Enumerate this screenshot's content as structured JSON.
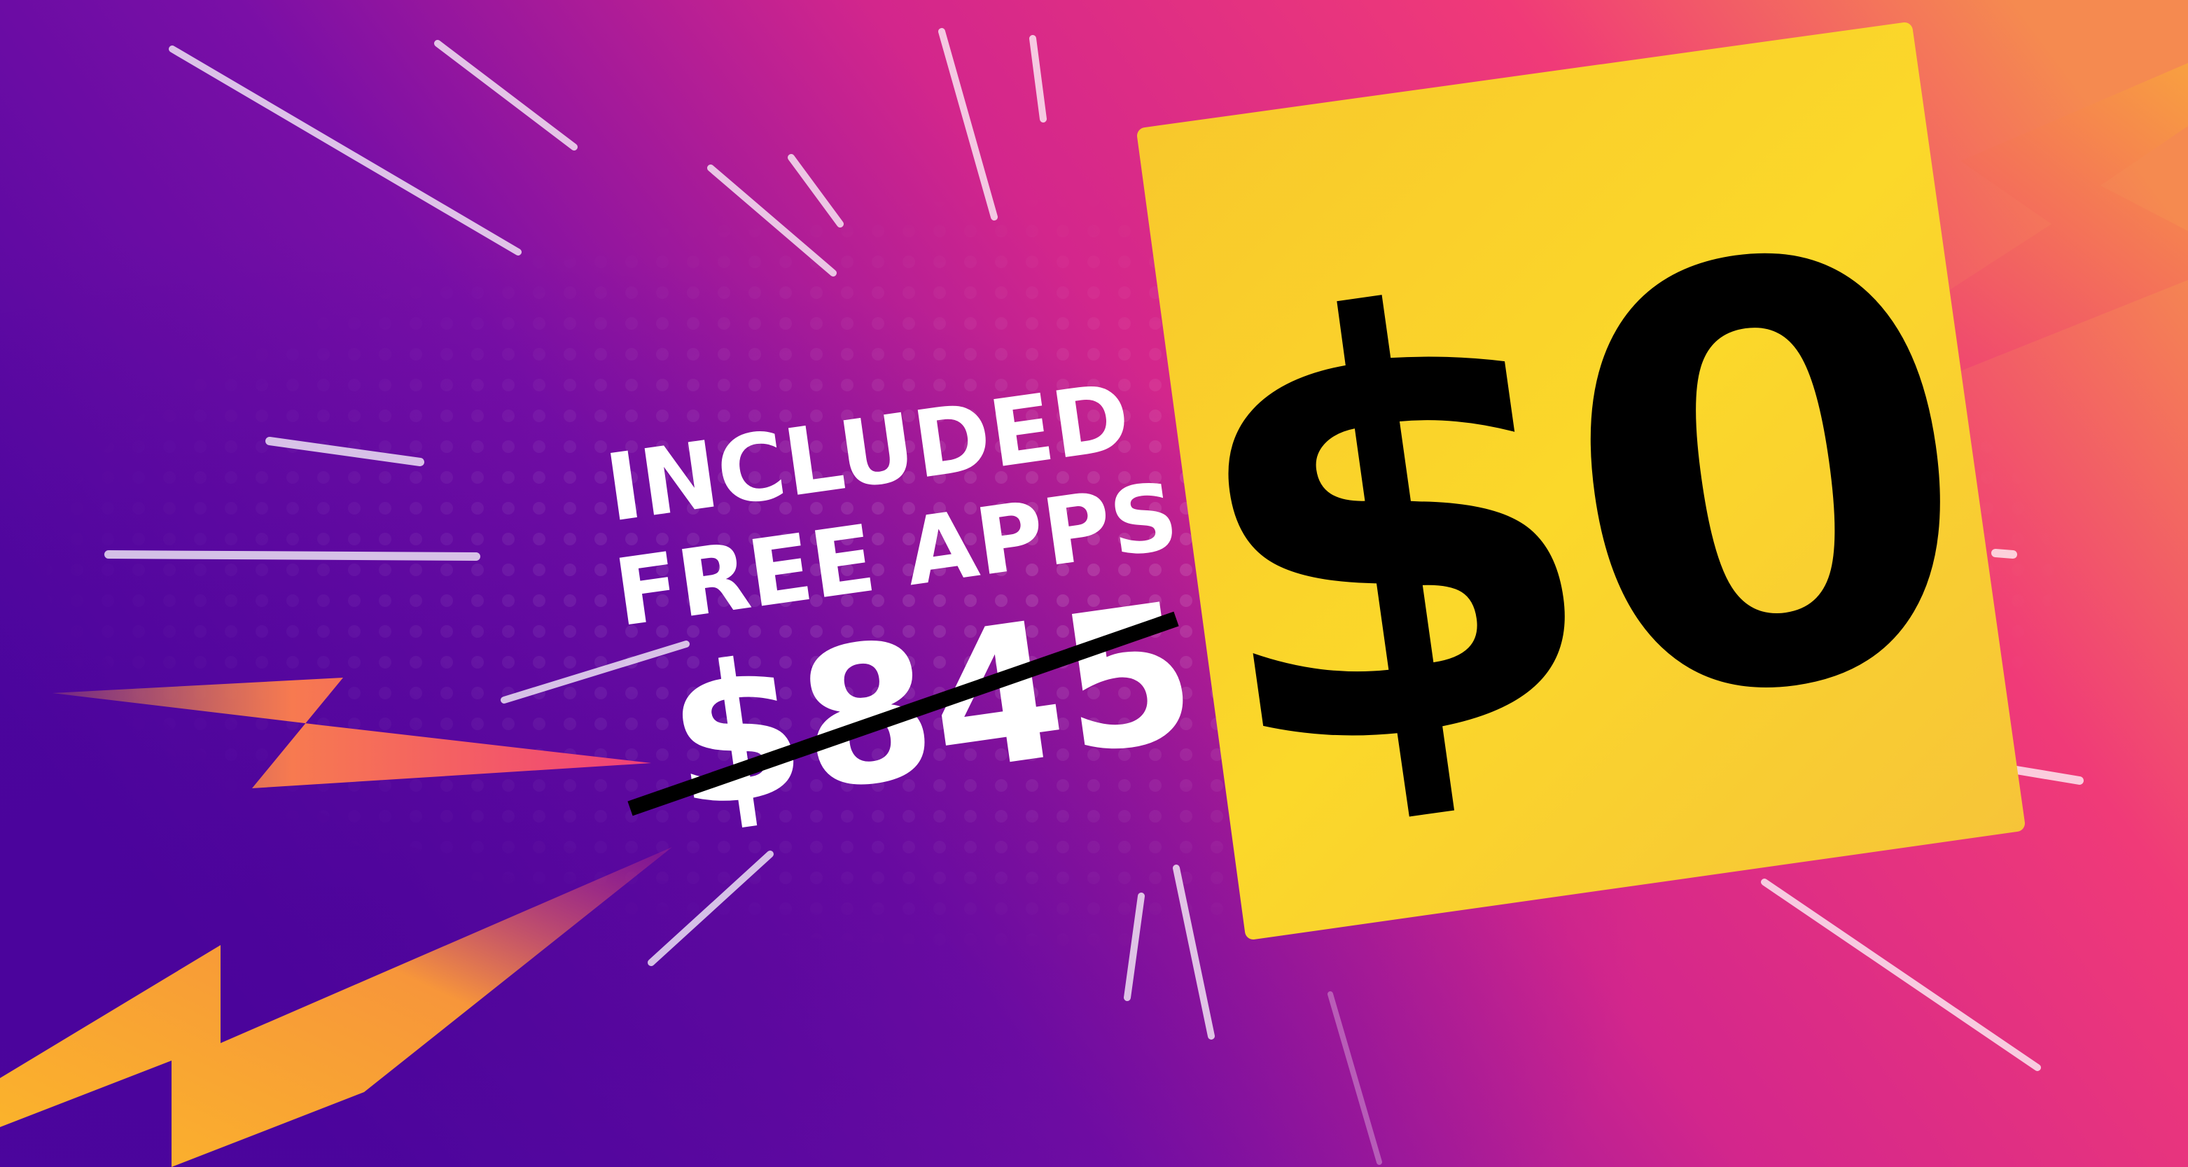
{
  "promo": {
    "line1": "INCLUDED",
    "line2": "FREE APPS",
    "old_price": "$845",
    "new_price": "$0"
  },
  "colors": {
    "background_left": "#56079f",
    "background_mid": "#d3268c",
    "background_right": "#f2466e",
    "card": "#f8c930",
    "price_text": "#000000",
    "label_text": "#ffffff",
    "bolt_orange": "#f7a23a",
    "bolt_pink": "#f0406a"
  }
}
